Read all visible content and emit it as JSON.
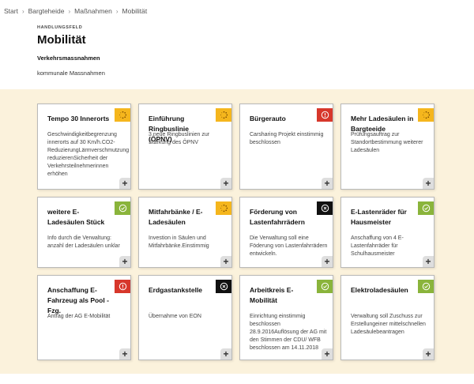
{
  "breadcrumb": [
    "Start",
    "Bargteheide",
    "Maßnahmen",
    "Mobilität"
  ],
  "header": {
    "kicker": "HANDLUNGSFELD",
    "title": "Mobilität",
    "subtitle": "Verkehrsmassnahmen",
    "description": "kommunale Massnahmen"
  },
  "colors": {
    "in_progress": "#f5b61d",
    "planned": "#8ab43b",
    "rejected": "#d7372b",
    "stopped": "#111111",
    "board_background": "#fbf2dc"
  },
  "cards": [
    {
      "title": "Tempo 30 Innerorts",
      "text": "Geschwindigkeitbegrenzung innerorts auf 30 Km/h.CO2-ReduzierungLärmverschmutzung reduzierenSicherheit der Verkehrsteilnehmerinnen erhöhen",
      "status": "in_progress",
      "status_icon": "loading-dots-icon"
    },
    {
      "title": "Einführung Ringbuslinie (ÖPNV)",
      "text": "3 neue Ringbuslinien zur Stärkung des ÖPNV",
      "status": "in_progress",
      "status_icon": "loading-dots-icon"
    },
    {
      "title": "Bürgerauto",
      "text": "Carsharing Projekt einstimmig beschlossen",
      "status": "rejected",
      "status_icon": "exclamation-icon"
    },
    {
      "title": "Mehr Ladesäulen in Bargteeide",
      "text": "Prüfungsauftrag zur Standortbestimmung weiterer Ladesäulen",
      "status": "in_progress",
      "status_icon": "loading-dots-icon"
    },
    {
      "title": "weitere E-Ladesäulen Stück",
      "text": "Info durch die Verwaltung: anzahl der Ladesäulen unklar",
      "status": "planned",
      "status_icon": "check-icon"
    },
    {
      "title": "Mitfahrbänke / E-Ladesäulen",
      "text": "Investion in Säulen und Mitfahrbänke.Einstimmig",
      "status": "in_progress",
      "status_icon": "loading-dots-icon"
    },
    {
      "title": "Förderung von Lastenfahrrädern",
      "text": "Die Verwaltung soll eine Föderung von Lastenfahrrädern entwickeln.",
      "status": "stopped",
      "status_icon": "x-circle-icon"
    },
    {
      "title": "E-Lastenräder für Hausmeister",
      "text": "Anschaffung von 4 E-Lastenfahrräder für Schulhausmeister",
      "status": "planned",
      "status_icon": "check-icon"
    },
    {
      "title": "Anschaffung E-Fahrzeug als Pool - Fzg.",
      "text": "Antrag der AG E-Mobilität",
      "status": "rejected",
      "status_icon": "exclamation-icon"
    },
    {
      "title": "Erdgastankstelle",
      "text": "Übernahme von EON",
      "status": "stopped",
      "status_icon": "x-circle-icon"
    },
    {
      "title": "Arbeitkreis E-Mobilität",
      "text": "Einrichtung einstimmig beschlossen 28.9.2016Auflösung der AG mit den Stimmen der CDU/ WFB beschlossen am 14.11.2018",
      "status": "planned",
      "status_icon": "check-icon"
    },
    {
      "title": "Elektroladesäulen",
      "text": "Verwaltung soll Zuschuss zur Erstellungeiner mittelschnellen Ladesäulebeantragen",
      "status": "planned",
      "status_icon": "check-icon"
    }
  ],
  "expand_label": "+"
}
